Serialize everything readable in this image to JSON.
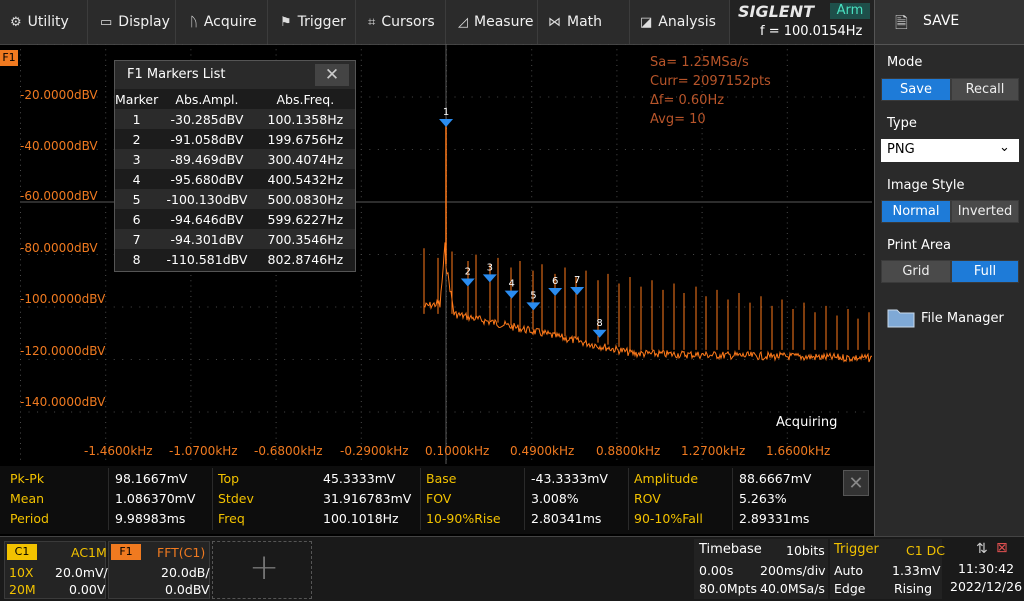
{
  "menu": {
    "utility": "Utility",
    "display": "Display",
    "acquire": "Acquire",
    "trigger": "Trigger",
    "cursors": "Cursors",
    "measure": "Measure",
    "math": "Math",
    "analysis": "Analysis"
  },
  "brand": {
    "name": "SIGLENT",
    "state": "Arm",
    "freq": "f = 100.0154Hz"
  },
  "right_panel": {
    "title": "SAVE",
    "mode_label": "Mode",
    "mode_options": [
      "Save",
      "Recall"
    ],
    "mode_selected": "Save",
    "type_label": "Type",
    "type_value": "PNG",
    "image_style_label": "Image Style",
    "image_style_options": [
      "Normal",
      "Inverted"
    ],
    "image_style_selected": "Normal",
    "print_area_label": "Print Area",
    "print_area_options": [
      "Grid",
      "Full"
    ],
    "print_area_selected": "Full",
    "file_manager": "File Manager"
  },
  "plot": {
    "channel_tag": "F1",
    "y_labels": [
      "-20.0000dBV",
      "-40.0000dBV",
      "-60.0000dBV",
      "-80.0000dBV",
      "-100.0000dBV",
      "-120.0000dBV",
      "-140.0000dBV"
    ],
    "x_labels": [
      "-1.4600kHz",
      "-1.0700kHz",
      "-0.6800kHz",
      "-0.2900kHz",
      "0.1000kHz",
      "0.4900kHz",
      "0.8800kHz",
      "1.2700kHz",
      "1.6600kHz"
    ],
    "info": [
      "Sa= 1.25MSa/s",
      "Curr= 2097152pts",
      "Δf= 0.60Hz",
      "Avg= 10"
    ],
    "status": "Acquiring",
    "trace_color": "#ff7a1a",
    "marker_color": "#2a8cf0"
  },
  "markers_list": {
    "title": "F1 Markers List",
    "headers": [
      "Marker",
      "Abs.Ampl.",
      "Abs.Freq."
    ],
    "rows": [
      [
        "1",
        "-30.285dBV",
        "100.1358Hz"
      ],
      [
        "2",
        "-91.058dBV",
        "199.6756Hz"
      ],
      [
        "3",
        "-89.469dBV",
        "300.4074Hz"
      ],
      [
        "4",
        "-95.680dBV",
        "400.5432Hz"
      ],
      [
        "5",
        "-100.130dBV",
        "500.0830Hz"
      ],
      [
        "6",
        "-94.646dBV",
        "599.6227Hz"
      ],
      [
        "7",
        "-94.301dBV",
        "700.3546Hz"
      ],
      [
        "8",
        "-110.581dBV",
        "802.8746Hz"
      ]
    ]
  },
  "measurements": {
    "rows": [
      [
        [
          "Pk-Pk",
          "98.1667mV"
        ],
        [
          "Top",
          "45.3333mV"
        ],
        [
          "Base",
          "-43.3333mV"
        ],
        [
          "Amplitude",
          "88.6667mV"
        ]
      ],
      [
        [
          "Mean",
          "1.086370mV"
        ],
        [
          "Stdev",
          "31.916783mV"
        ],
        [
          "FOV",
          "3.008%"
        ],
        [
          "ROV",
          "5.263%"
        ]
      ],
      [
        [
          "Period",
          "9.98983ms"
        ],
        [
          "Freq",
          "100.1018Hz"
        ],
        [
          "10-90%Rise",
          "2.80341ms"
        ],
        [
          "90-10%Fall",
          "2.89331ms"
        ]
      ]
    ]
  },
  "status_bar": {
    "c1": {
      "tag": "C1",
      "coupling": "AC1M",
      "probe": "10X",
      "scale": "20.0mV/",
      "bw": "20M",
      "offset": "0.00V"
    },
    "f1": {
      "tag": "F1",
      "source": "FFT(C1)",
      "scale": "20.0dB/",
      "offset": "0.0dBV"
    },
    "timebase": {
      "label": "Timebase",
      "bits": "10bits",
      "delay": "0.00s",
      "scale": "200ms/div",
      "mpts": "80.0Mpts",
      "rate": "40.0MSa/s"
    },
    "trigger": {
      "label": "Trigger",
      "source": "C1 DC",
      "mode": "Auto",
      "level": "1.33mV",
      "type": "Edge",
      "slope": "Rising"
    },
    "clock": {
      "time": "11:30:42",
      "date": "2022/12/26"
    }
  }
}
